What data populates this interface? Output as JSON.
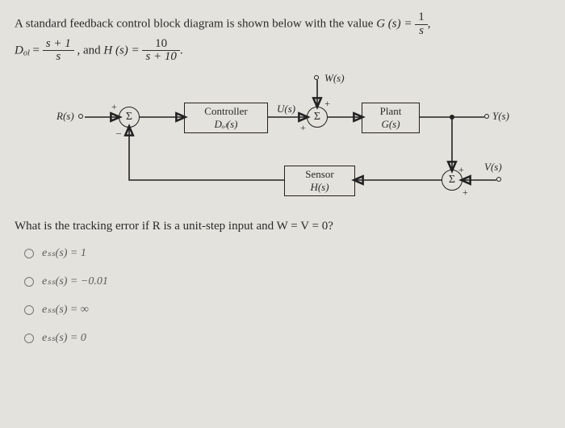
{
  "problem": {
    "intro_a": "A standard feedback control block diagram is shown below with the value ",
    "G_eq_lhs": "G (s) = ",
    "G_frac_num": "1",
    "G_frac_den": "s",
    "comma1": ",",
    "Dol_lhs": "D",
    "Dol_sub": "ol",
    "Dol_eq": " = ",
    "D_frac_num": "s + 1",
    "D_frac_den": "s",
    "between": ", and ",
    "H_lhs": "H (s) = ",
    "H_frac_num": "10",
    "H_frac_den": "s + 10",
    "period": "."
  },
  "diagram_labels": {
    "R": "R(s)",
    "U": "U(s)",
    "W": "W(s)",
    "Y": "Y(s)",
    "V": "V(s)",
    "sum": "Σ",
    "controller_t": "Controller",
    "controller_b": "Dₒₗ(s)",
    "plant_t": "Plant",
    "plant_b": "G(s)",
    "sensor_t": "Sensor",
    "sensor_b": "H(s)",
    "plus": "+",
    "minus": "–"
  },
  "question": "What is the tracking error if R is a unit-step input and W = V = 0?",
  "options": [
    {
      "label": "eₛₛ(s) = 1"
    },
    {
      "label": "eₛₛ(s) = −0.01"
    },
    {
      "label": "eₛₛ(s) = ∞"
    },
    {
      "label": "eₛₛ(s) = 0"
    }
  ]
}
